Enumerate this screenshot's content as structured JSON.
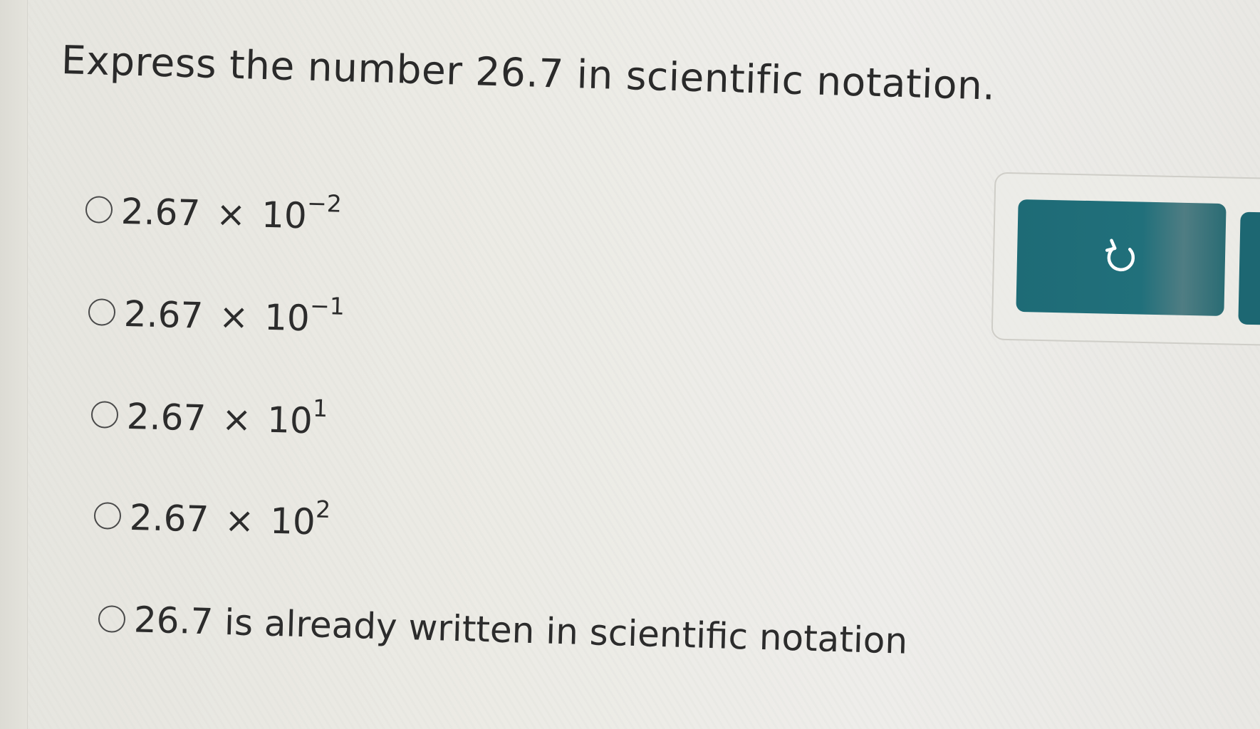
{
  "question": {
    "text": "Express the number 26.7 in scientific notation."
  },
  "options": [
    {
      "mantissa": "2.67",
      "times": "×",
      "base": "10",
      "exponent": "−2",
      "selected": false
    },
    {
      "mantissa": "2.67",
      "times": "×",
      "base": "10",
      "exponent": "−1",
      "selected": false
    },
    {
      "mantissa": "2.67",
      "times": "×",
      "base": "10",
      "exponent": "1",
      "selected": false
    },
    {
      "mantissa": "2.67",
      "times": "×",
      "base": "10",
      "exponent": "2",
      "selected": false
    },
    {
      "text": "26.7 is already written in scientific notation",
      "selected": false
    }
  ],
  "controls": {
    "undo_icon": "undo-icon",
    "accent_color": "#1e6b76"
  }
}
